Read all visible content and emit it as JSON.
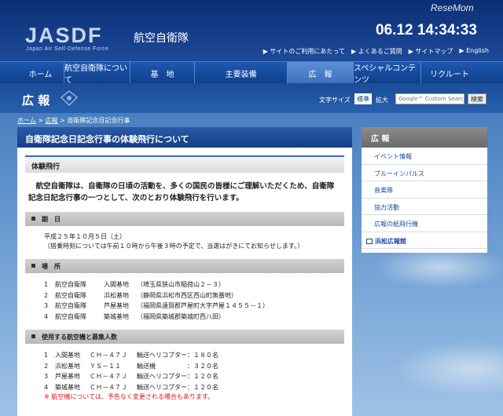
{
  "watermark": "ReseMom",
  "header": {
    "logo": "JASDF",
    "logo_sub": "Japan Air Self-Defense Force",
    "org_name": "航空自衛隊",
    "clock": "06.12 14:34:33",
    "util_links": [
      "▶ サイトのご利用にあたって",
      "▶ よくあるご質問",
      "▶ サイトマップ",
      "▶ English"
    ]
  },
  "nav": {
    "items": [
      "ホーム",
      "航空自衛隊について",
      "基　地",
      "主要装備",
      "広　報",
      "スペシャルコンテンツ",
      "リクルート"
    ],
    "active_index": 4
  },
  "pagehead": {
    "title": "広 報",
    "font_size_label": "文字サイズ",
    "standard_label": "標準",
    "large_label": "拡大",
    "search_placeholder": "Google™ Custom Search",
    "search_button": "検索"
  },
  "breadcrumb": {
    "home": "ホーム",
    "sep1": " > ",
    "pr": "広報",
    "sep2": " > ",
    "current": "自衛隊記念日記念行事"
  },
  "main": {
    "title": "自衛隊記念日記念行事の体験飛行について",
    "section": "体験飛行",
    "lead": "　航空自衛隊は、自衛隊の日頃の活動を、多くの国民の皆様にご理解いただくため、自衛隊記念日記念行事の一つとして、次のとおり体験飛行を行います。",
    "bar_date": "期　日",
    "date_line1": "平成２５年１０月５日（土）",
    "date_line2": "（搭乗時刻については午前１０時から午後３時の予定で、当選はがきにてお知らせします。）",
    "bar_place": "場　所",
    "places": [
      {
        "num": "1",
        "unit": "航空自衛隊",
        "base": "入間基地",
        "addr": "（埼玉県狭山市稲荷山２－３）"
      },
      {
        "num": "2",
        "unit": "航空自衛隊",
        "base": "浜松基地",
        "addr": "（静岡県浜松市西区西山町無番地）"
      },
      {
        "num": "3",
        "unit": "航空自衛隊",
        "base": "芦屋基地",
        "addr": "（福岡県遠賀郡芦屋町大字芦屋１４５５－１）"
      },
      {
        "num": "4",
        "unit": "航空自衛隊",
        "base": "築城基地",
        "addr": "（福岡県築城郡築城町西八田）"
      }
    ],
    "bar_aircraft": "使用する航空機と募集人数",
    "aircraft": [
      {
        "num": "1",
        "base": "入間基地",
        "model": "ＣＨ－４７Ｊ",
        "type": "輸送ヘリコプター：１８０名"
      },
      {
        "num": "2",
        "base": "浜松基地",
        "model": "ＹＳ－１１",
        "type": "輸送機　　　　　：３２０名"
      },
      {
        "num": "3",
        "base": "芦屋基地",
        "model": "ＣＨ－４７Ｊ",
        "type": "輸送ヘリコプター：１２０名"
      },
      {
        "num": "4",
        "base": "築城基地",
        "model": "ＣＨ－４７Ｊ",
        "type": "輸送ヘリコプター：１２０名"
      }
    ],
    "note": "※ 航空機については、予告なく変更される場合もあります。"
  },
  "side": {
    "title": "広 報",
    "items": [
      "イベント情報",
      "ブルーインパルス",
      "音楽隊",
      "協力活動",
      "広報の紙飛行機"
    ],
    "ext_item": "浜松広報館"
  }
}
